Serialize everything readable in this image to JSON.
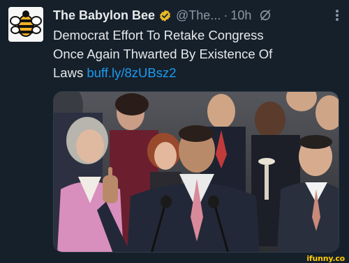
{
  "tweet": {
    "author_name": "The Babylon Bee",
    "handle": "@The...",
    "separator": "·",
    "time": "10h",
    "line1": "Democrat Effort To Retake Congress",
    "line2": "Once Again Thwarted By Existence Of",
    "line3_prefix": "Laws",
    "link": "buff.ly/8zUBsz2"
  },
  "icons": {
    "avatar": "babylon-bee-logo",
    "verified": "gold-verified-badge",
    "grok": "grok-icon",
    "more": "more-options-icon"
  },
  "colors": {
    "background": "#15202b",
    "link": "#1d9bf0",
    "verified_gold": "#e8b829",
    "watermark": "#ffcc00"
  },
  "watermark": "ifunny.co"
}
